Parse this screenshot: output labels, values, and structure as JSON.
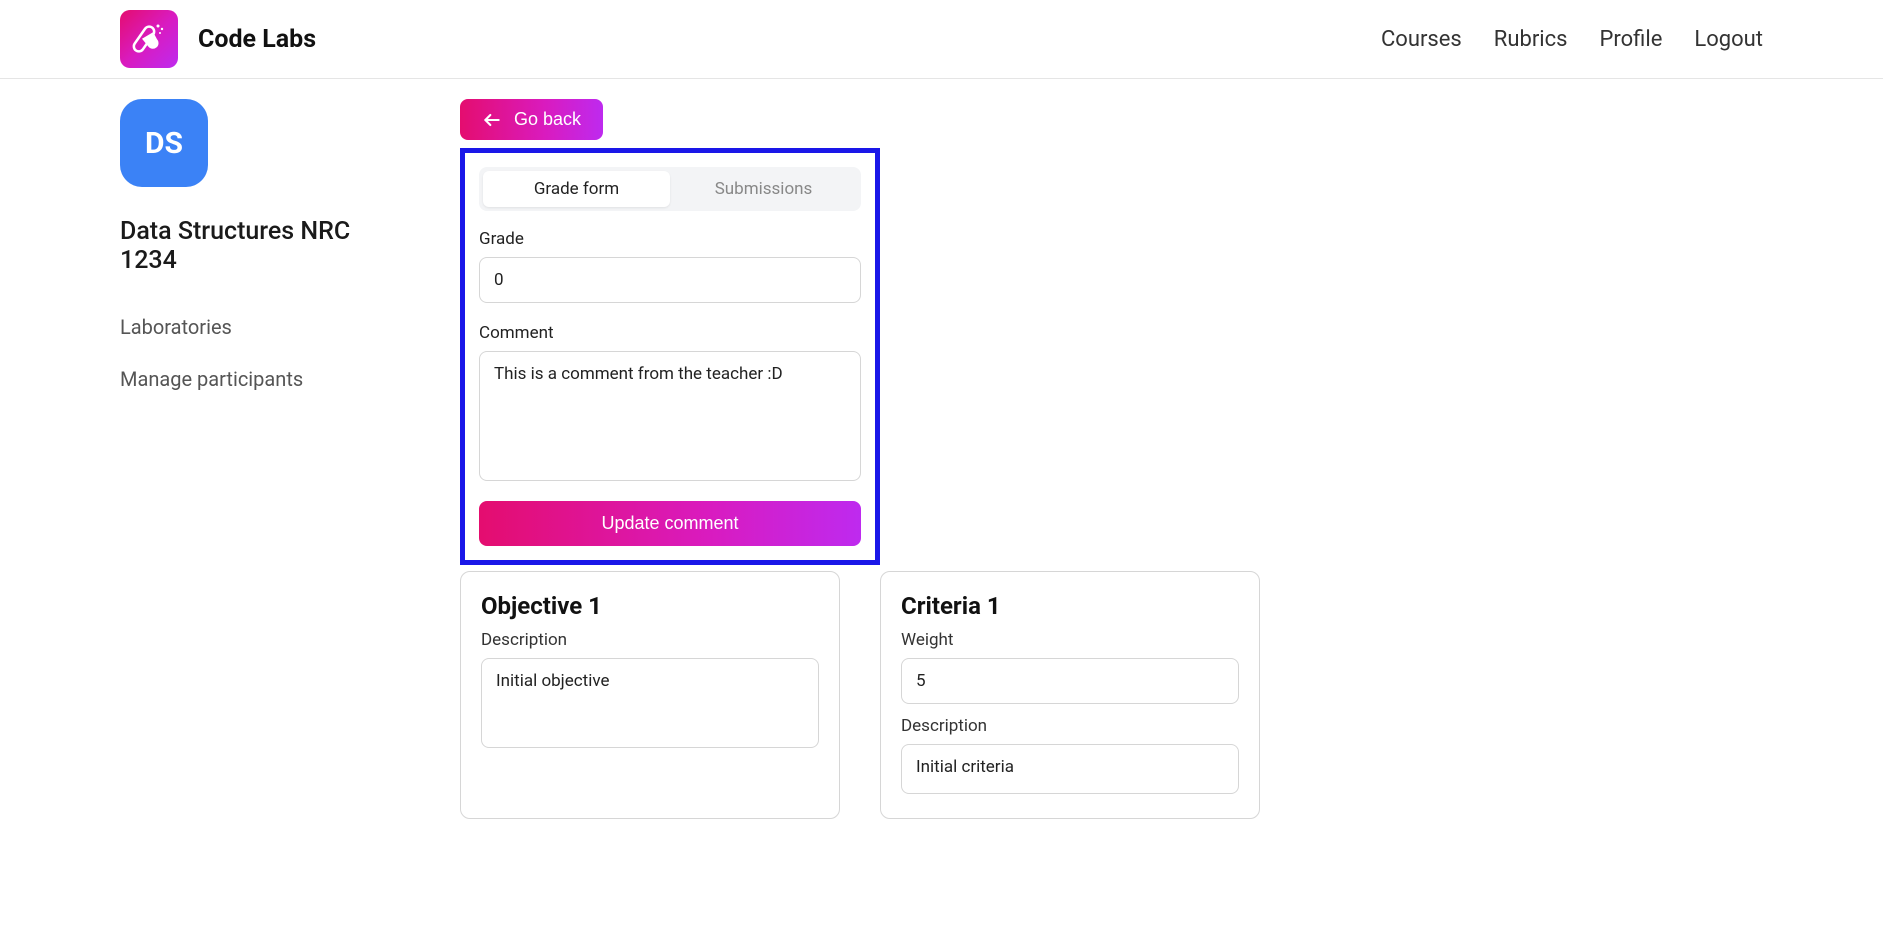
{
  "header": {
    "brand": "Code Labs",
    "nav": {
      "courses": "Courses",
      "rubrics": "Rubrics",
      "profile": "Profile",
      "logout": "Logout"
    }
  },
  "sidebar": {
    "badge": "DS",
    "course_title": "Data Structures NRC 1234",
    "links": {
      "laboratories": "Laboratories",
      "manage_participants": "Manage participants"
    }
  },
  "main": {
    "go_back": "Go back",
    "tabs": {
      "grade_form": "Grade form",
      "submissions": "Submissions"
    },
    "grade_form": {
      "grade_label": "Grade",
      "grade_value": "0",
      "comment_label": "Comment",
      "comment_value": "This is a comment from the teacher :D",
      "update_button": "Update comment"
    },
    "objective": {
      "title": "Objective 1",
      "description_label": "Description",
      "description_value": "Initial objective"
    },
    "criteria": {
      "title": "Criteria 1",
      "weight_label": "Weight",
      "weight_value": "5",
      "description_label": "Description",
      "description_value": "Initial criteria"
    }
  }
}
